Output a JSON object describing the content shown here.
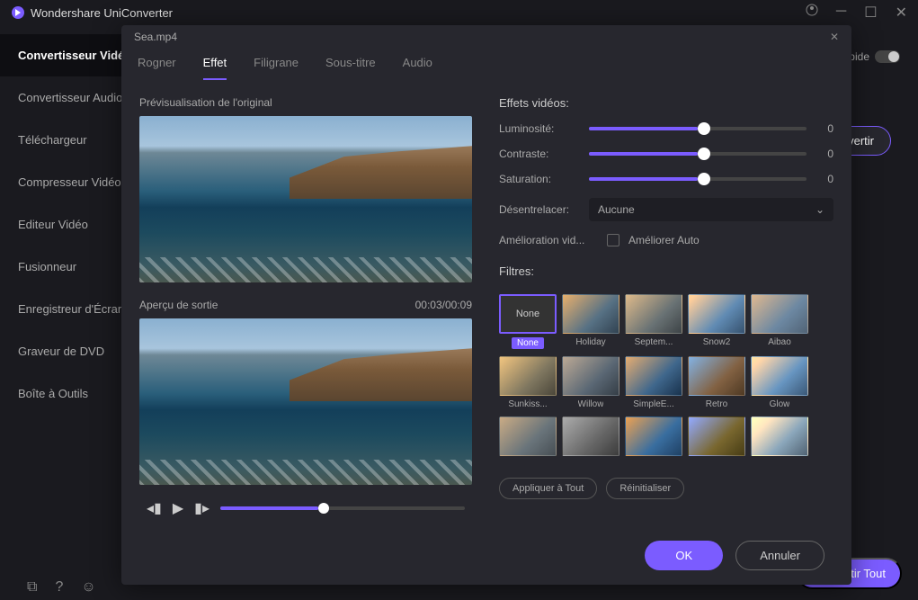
{
  "app": {
    "title": "Wondershare UniConverter"
  },
  "sidebar": {
    "items": [
      {
        "label": "Convertisseur Vidéo"
      },
      {
        "label": "Convertisseur Audio"
      },
      {
        "label": "Téléchargeur"
      },
      {
        "label": "Compresseur Vidéo"
      },
      {
        "label": "Editeur Vidéo"
      },
      {
        "label": "Fusionneur"
      },
      {
        "label": "Enregistreur d'Écran"
      },
      {
        "label": "Graveur de DVD"
      },
      {
        "label": "Boîte à Outils"
      }
    ]
  },
  "main": {
    "rapid_label": "rapide",
    "convert_btn": "Convertir",
    "convert_all": "Convertir Tout"
  },
  "modal": {
    "filename": "Sea.mp4",
    "tabs": [
      {
        "label": "Rogner"
      },
      {
        "label": "Effet"
      },
      {
        "label": "Filigrane"
      },
      {
        "label": "Sous-titre"
      },
      {
        "label": "Audio"
      }
    ],
    "preview_original": "Prévisualisation de l'original",
    "preview_output": "Aperçu de sortie",
    "timecode": "00:03/00:09",
    "effects": {
      "heading": "Effets vidéos:",
      "brightness": {
        "label": "Luminosité:",
        "value": "0"
      },
      "contrast": {
        "label": "Contraste:",
        "value": "0"
      },
      "saturation": {
        "label": "Saturation:",
        "value": "0"
      },
      "deinterlace": {
        "label": "Désentrelacer:",
        "value": "Aucune"
      },
      "enhance_label": "Amélioration vid...",
      "enhance_auto": "Améliorer Auto"
    },
    "filters": {
      "heading": "Filtres:",
      "items": [
        {
          "name": "None"
        },
        {
          "name": "Holiday"
        },
        {
          "name": "Septem..."
        },
        {
          "name": "Snow2"
        },
        {
          "name": "Aibao"
        },
        {
          "name": "Sunkiss..."
        },
        {
          "name": "Willow"
        },
        {
          "name": "SimpleE..."
        },
        {
          "name": "Retro"
        },
        {
          "name": "Glow"
        },
        {
          "name": ""
        },
        {
          "name": ""
        },
        {
          "name": ""
        },
        {
          "name": ""
        },
        {
          "name": ""
        }
      ],
      "apply_all": "Appliquer à Tout",
      "reset": "Réinitialiser"
    },
    "ok": "OK",
    "cancel": "Annuler"
  }
}
